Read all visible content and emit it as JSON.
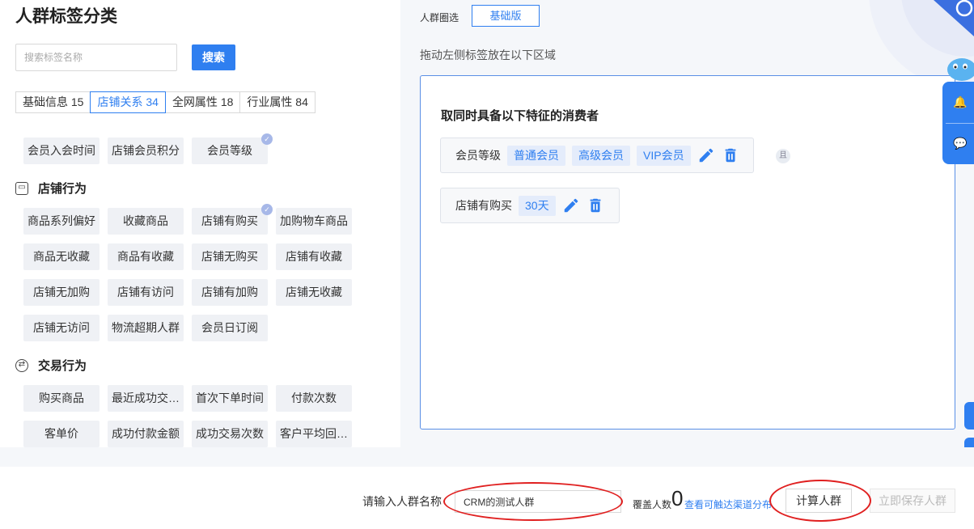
{
  "page_title": "人群标签分类",
  "search": {
    "placeholder": "搜索标签名称",
    "button_label": "搜索"
  },
  "tabs": [
    {
      "label": "基础信息 15",
      "active": false
    },
    {
      "label": "店铺关系 34",
      "active": true
    },
    {
      "label": "全网属性 18",
      "active": false
    },
    {
      "label": "行业属性 84",
      "active": false
    }
  ],
  "member_tags": [
    "会员入会时间",
    "店铺会员积分",
    "会员等级"
  ],
  "sections": {
    "store_behavior": {
      "label": "店铺行为",
      "tags": [
        "商品系列偏好",
        "收藏商品",
        "店铺有购买",
        "加购物车商品",
        "商品无收藏",
        "商品有收藏",
        "店铺无购买",
        "店铺有收藏",
        "店铺无加购",
        "店铺有访问",
        "店铺有加购",
        "店铺无收藏",
        "店铺无访问",
        "物流超期人群",
        "会员日订阅"
      ]
    },
    "trade_behavior": {
      "label": "交易行为",
      "tags": [
        "购买商品",
        "最近成功交…",
        "首次下单时间",
        "付款次数",
        "客单价",
        "成功付款金额",
        "成功交易次数",
        "客户平均回…"
      ]
    }
  },
  "builder": {
    "mode_label": "人群圈选",
    "mode_button": "基础版",
    "drag_hint": "拖动左侧标签放在以下区域",
    "condition_title": "取同时具备以下特征的消费者",
    "and_label": "且",
    "rules": [
      {
        "label": "会员等级",
        "values": [
          "普通会员",
          "高级会员",
          "VIP会员"
        ]
      },
      {
        "label": "店铺有购买",
        "values": [
          "30天"
        ]
      }
    ]
  },
  "footer": {
    "name_label": "请输入人群名称",
    "name_value": "CRM的测试人群",
    "coverage_label": "覆盖人数",
    "coverage_value": "0",
    "channel_link": "查看可触达渠道分布",
    "calc_button": "计算人群",
    "save_button": "立即保存人群"
  },
  "colors": {
    "accent": "#2f7ff0",
    "highlight": "#e02020"
  }
}
